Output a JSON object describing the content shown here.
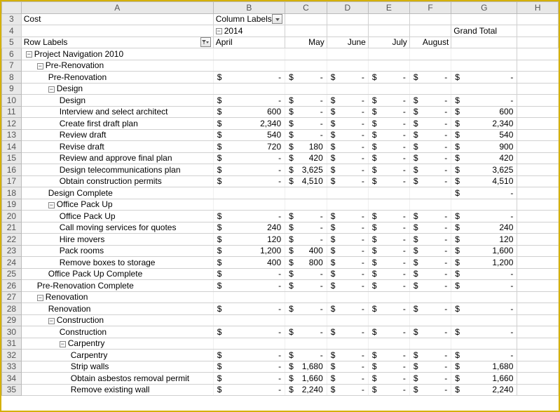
{
  "columnHeaders": [
    "A",
    "B",
    "C",
    "D",
    "E",
    "F",
    "G",
    "H"
  ],
  "header": {
    "cost": "Cost",
    "columnLabels": "Column Labels",
    "year": "2014",
    "grandTotal": "Grand Total",
    "rowLabels": "Row Labels",
    "months": [
      "April",
      "May",
      "June",
      "July",
      "August"
    ]
  },
  "expand": "−",
  "collapse": "+",
  "rows": [
    {
      "n": 6,
      "lvl": 0,
      "expand": true,
      "label": "Project Navigation 2010",
      "vals": [
        null,
        null,
        null,
        null,
        null,
        null
      ]
    },
    {
      "n": 7,
      "lvl": 1,
      "expand": true,
      "label": "Pre-Renovation",
      "vals": [
        null,
        null,
        null,
        null,
        null,
        null
      ]
    },
    {
      "n": 8,
      "lvl": 2,
      "label": "Pre-Renovation",
      "vals": [
        "-",
        "-",
        "-",
        "-",
        "-",
        "-"
      ]
    },
    {
      "n": 9,
      "lvl": 2,
      "expand": true,
      "label": "Design",
      "vals": [
        null,
        null,
        null,
        null,
        null,
        null
      ]
    },
    {
      "n": 10,
      "lvl": 3,
      "label": "Design",
      "vals": [
        "-",
        "-",
        "-",
        "-",
        "-",
        "-"
      ]
    },
    {
      "n": 11,
      "lvl": 3,
      "label": "Interview and select architect",
      "vals": [
        "600",
        "-",
        "-",
        "-",
        "-",
        "600"
      ]
    },
    {
      "n": 12,
      "lvl": 3,
      "label": "Create first draft plan",
      "vals": [
        "2,340",
        "-",
        "-",
        "-",
        "-",
        "2,340"
      ]
    },
    {
      "n": 13,
      "lvl": 3,
      "label": "Review draft",
      "vals": [
        "540",
        "-",
        "-",
        "-",
        "-",
        "540"
      ]
    },
    {
      "n": 14,
      "lvl": 3,
      "label": "Revise draft",
      "vals": [
        "720",
        "180",
        "-",
        "-",
        "-",
        "900"
      ]
    },
    {
      "n": 15,
      "lvl": 3,
      "label": "Review and approve final plan",
      "vals": [
        "-",
        "420",
        "-",
        "-",
        "-",
        "420"
      ]
    },
    {
      "n": 16,
      "lvl": 3,
      "label": "Design telecommunications plan",
      "vals": [
        "-",
        "3,625",
        "-",
        "-",
        "-",
        "3,625"
      ]
    },
    {
      "n": 17,
      "lvl": 3,
      "label": "Obtain construction permits",
      "vals": [
        "-",
        "4,510",
        "-",
        "-",
        "-",
        "4,510"
      ]
    },
    {
      "n": 18,
      "lvl": 2,
      "label": "Design Complete",
      "vals": [
        null,
        null,
        null,
        null,
        null,
        "-"
      ]
    },
    {
      "n": 19,
      "lvl": 2,
      "expand": true,
      "label": "Office Pack Up",
      "vals": [
        null,
        null,
        null,
        null,
        null,
        null
      ]
    },
    {
      "n": 20,
      "lvl": 3,
      "label": "Office Pack Up",
      "vals": [
        "-",
        "-",
        "-",
        "-",
        "-",
        "-"
      ]
    },
    {
      "n": 21,
      "lvl": 3,
      "label": "Call moving services for quotes",
      "vals": [
        "240",
        "-",
        "-",
        "-",
        "-",
        "240"
      ]
    },
    {
      "n": 22,
      "lvl": 3,
      "label": "Hire movers",
      "vals": [
        "120",
        "-",
        "-",
        "-",
        "-",
        "120"
      ]
    },
    {
      "n": 23,
      "lvl": 3,
      "label": "Pack rooms",
      "vals": [
        "1,200",
        "400",
        "-",
        "-",
        "-",
        "1,600"
      ]
    },
    {
      "n": 24,
      "lvl": 3,
      "label": "Remove boxes to storage",
      "vals": [
        "400",
        "800",
        "-",
        "-",
        "-",
        "1,200"
      ]
    },
    {
      "n": 25,
      "lvl": 2,
      "label": "Office Pack Up Complete",
      "vals": [
        "-",
        "-",
        "-",
        "-",
        "-",
        "-"
      ]
    },
    {
      "n": 26,
      "lvl": 1,
      "label": "Pre-Renovation Complete",
      "vals": [
        "-",
        "-",
        "-",
        "-",
        "-",
        "-"
      ]
    },
    {
      "n": 27,
      "lvl": 1,
      "expand": true,
      "label": "Renovation",
      "vals": [
        null,
        null,
        null,
        null,
        null,
        null
      ]
    },
    {
      "n": 28,
      "lvl": 2,
      "label": "Renovation",
      "vals": [
        "-",
        "-",
        "-",
        "-",
        "-",
        "-"
      ]
    },
    {
      "n": 29,
      "lvl": 2,
      "expand": true,
      "label": "Construction",
      "vals": [
        null,
        null,
        null,
        null,
        null,
        null
      ]
    },
    {
      "n": 30,
      "lvl": 3,
      "label": "Construction",
      "vals": [
        "-",
        "-",
        "-",
        "-",
        "-",
        "-"
      ]
    },
    {
      "n": 31,
      "lvl": 3,
      "expand": true,
      "label": "Carpentry",
      "vals": [
        null,
        null,
        null,
        null,
        null,
        null
      ]
    },
    {
      "n": 32,
      "lvl": 4,
      "label": "Carpentry",
      "vals": [
        "-",
        "-",
        "-",
        "-",
        "-",
        "-"
      ]
    },
    {
      "n": 33,
      "lvl": 4,
      "label": "Strip walls",
      "vals": [
        "-",
        "1,680",
        "-",
        "-",
        "-",
        "1,680"
      ]
    },
    {
      "n": 34,
      "lvl": 4,
      "label": "Obtain asbestos removal permit",
      "vals": [
        "-",
        "1,660",
        "-",
        "-",
        "-",
        "1,660"
      ]
    },
    {
      "n": 35,
      "lvl": 4,
      "label": "Remove existing wall",
      "vals": [
        "-",
        "2,240",
        "-",
        "-",
        "-",
        "2,240"
      ]
    }
  ]
}
